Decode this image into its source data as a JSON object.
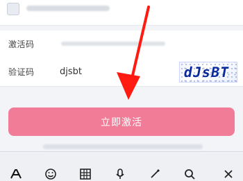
{
  "form": {
    "activation_label": "激活码",
    "verify_label": "验证码",
    "verify_value": "djsbt",
    "captcha_text": "dJsBT",
    "blurred_email": "••••••••••••••••",
    "blurred_activation": "••••••••••••••••••••••"
  },
  "actions": {
    "activate_label": "立即激活"
  },
  "hint": {
    "text": "•••••••••••••••••••••••••••••••••••"
  },
  "toolbar": {
    "items": [
      {
        "icon": "keyboard-switch-icon"
      },
      {
        "icon": "emoji-icon"
      },
      {
        "icon": "grid-icon"
      },
      {
        "icon": "mic-icon"
      },
      {
        "icon": "handwrite-icon"
      },
      {
        "icon": "search-icon"
      },
      {
        "icon": "close-icon"
      }
    ]
  },
  "colors": {
    "primary_button": "#f07c98",
    "arrow": "#ff1b12",
    "captcha": "#0a2a9a"
  }
}
